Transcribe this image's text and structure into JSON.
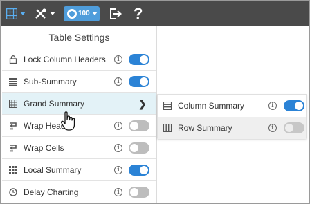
{
  "toolbar": {
    "items": [
      {
        "name": "grid-menu",
        "icon": "grid-icon",
        "has_caret": true
      },
      {
        "name": "tools-menu",
        "icon": "tools-icon",
        "has_caret": true
      },
      {
        "name": "badge",
        "icon": "award-icon",
        "value": "100",
        "has_caret": true
      },
      {
        "name": "export",
        "icon": "export-icon"
      },
      {
        "name": "help",
        "label": "?"
      }
    ],
    "badge_value": "100",
    "help_label": "?"
  },
  "panel": {
    "title": "Table Settings",
    "items": [
      {
        "label": "Lock Column Headers",
        "icon": "lock-icon",
        "toggle": "on"
      },
      {
        "label": "Sub-Summary",
        "icon": "sub-summary-icon",
        "toggle": "on"
      },
      {
        "label": "Grand Summary",
        "icon": "grand-summary-icon",
        "submenu": true
      },
      {
        "label": "Wrap Head",
        "icon": "wrap-headers-icon",
        "toggle": "off"
      },
      {
        "label": "Wrap Cells",
        "icon": "wrap-cells-icon",
        "toggle": "off"
      },
      {
        "label": "Local Summary",
        "icon": "local-summary-icon",
        "toggle": "on"
      },
      {
        "label": "Delay Charting",
        "icon": "delay-charting-icon",
        "toggle": "off"
      }
    ],
    "info_glyph": "i"
  },
  "submenu": {
    "items": [
      {
        "label": "Column Summary",
        "icon": "column-summary-icon",
        "toggle": "on"
      },
      {
        "label": "Row Summary",
        "icon": "row-summary-icon",
        "toggle": "disabled"
      }
    ]
  },
  "colors": {
    "toolbar_bg": "#4a4a4a",
    "accent": "#2b83d6",
    "badge": "#4f9ddb",
    "active_row": "#e3f2f7"
  }
}
